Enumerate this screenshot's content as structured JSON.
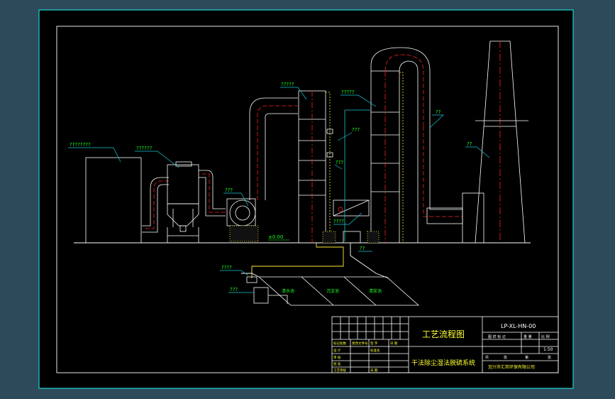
{
  "colors": {
    "background": "#2c4a5a",
    "sheet": "#000000",
    "frame": "#1fd3d3",
    "line": "#ffffff",
    "pipe_centerline": "#ff2020",
    "annotation": "#1fff1f",
    "leader": "#19c8d6",
    "insulation": "#ffee33",
    "title_text": "#ffff33"
  },
  "labels": {
    "precollector": "????????",
    "filter": "??????",
    "fan": "???",
    "tower1_top": "?????",
    "tower2_top": "?????",
    "middle_upper": "???",
    "middle_lower": "???",
    "duct": "??",
    "chimney": "??",
    "pump_left": "????",
    "tank": "???",
    "tower2_mid": "????",
    "pipe_right": "??",
    "elevation": "±0.00",
    "pool1": "清水池",
    "pool2": "沉淀池",
    "pool3": "清浆池"
  },
  "title_block": {
    "drawing_number": "LP-XL-HN-00",
    "scale": "1:50",
    "title": "工艺流程图",
    "subtitle": "干法除尘湿法脱硫系统",
    "company": "宜兴市汇邦环保有限公司",
    "header_cells": [
      "图 样 标 记",
      "重 量",
      "比 例"
    ],
    "sheet_cells": [
      "共",
      "张",
      "第",
      "张"
    ],
    "left_rows": [
      "标记处数",
      "更改文件号",
      "签 字",
      "日 期",
      "设 计",
      "标准化",
      "审 核",
      "批 准",
      "工艺审核",
      "日 期"
    ]
  }
}
